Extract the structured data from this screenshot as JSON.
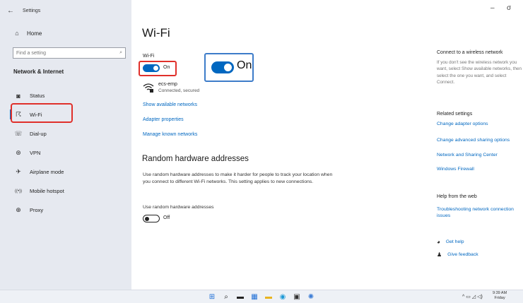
{
  "window": {
    "title": "Settings",
    "controls": {
      "minimize": "–",
      "maximize": "σ"
    }
  },
  "sidebar": {
    "home": "Home",
    "search_placeholder": "Find a setting",
    "section": "Network & Internet",
    "items": [
      {
        "label": "Status",
        "icon": "status-icon",
        "glyph": "◙"
      },
      {
        "label": "Wi-Fi",
        "icon": "wifi-icon",
        "glyph": "☈",
        "active": true
      },
      {
        "label": "Dial-up",
        "icon": "dialup-icon",
        "glyph": "☏"
      },
      {
        "label": "VPN",
        "icon": "vpn-icon",
        "glyph": "⊛"
      },
      {
        "label": "Airplane mode",
        "icon": "airplane-icon",
        "glyph": "✈"
      },
      {
        "label": "Mobile hotspot",
        "icon": "hotspot-icon",
        "glyph": "((•))"
      },
      {
        "label": "Proxy",
        "icon": "proxy-icon",
        "glyph": "⊕"
      }
    ]
  },
  "main": {
    "title": "Wi-Fi",
    "wifi_label": "Wi-Fi",
    "toggle_state": "On",
    "zoom_label": "On",
    "network": {
      "name": "ecs-emp",
      "status": "Connected, secured"
    },
    "links": {
      "show_available": "Show available networks",
      "adapter_properties": "Adapter properties",
      "manage_known": "Manage known networks"
    },
    "random_hw": {
      "heading": "Random hardware addresses",
      "description": "Use random hardware addresses to make it harder for people to track your location when you connect to different Wi-Fi networks. This setting applies to new connections.",
      "label": "Use random hardware addresses",
      "state": "Off"
    }
  },
  "right": {
    "connect_title": "Connect to a wireless network",
    "connect_desc": "If you don't see the wireless network you want, select Show available networks, then select the one you want, and select Connect.",
    "related_title": "Related settings",
    "related_links": [
      "Change adapter options",
      "Change advanced sharing options",
      "Network and Sharing Center",
      "Windows Firewall"
    ],
    "help_title": "Help from the web",
    "help_link": "Troubleshooting network connection issues",
    "get_help": "Get help",
    "give_feedback": "Give feedback"
  },
  "taskbar": {
    "icons": [
      {
        "name": "windows-start-icon",
        "glyph": "⊞",
        "color": "#1f6fd6"
      },
      {
        "name": "search-icon",
        "glyph": "⌕",
        "color": "#222222"
      },
      {
        "name": "task-view-icon",
        "glyph": "▬",
        "color": "#222222"
      },
      {
        "name": "widgets-icon",
        "glyph": "▦",
        "color": "#1f6fd6"
      },
      {
        "name": "file-explorer-icon",
        "glyph": "▬",
        "color": "#e8b420"
      },
      {
        "name": "edge-icon",
        "glyph": "◉",
        "color": "#1f9ad6"
      },
      {
        "name": "store-icon",
        "glyph": "▣",
        "color": "#333333"
      },
      {
        "name": "settings-icon",
        "glyph": "✺",
        "color": "#3a7bd5"
      }
    ],
    "tray": "^ ▭ ◿ ◁)",
    "time": "9:39 AM",
    "day": "Friday"
  }
}
